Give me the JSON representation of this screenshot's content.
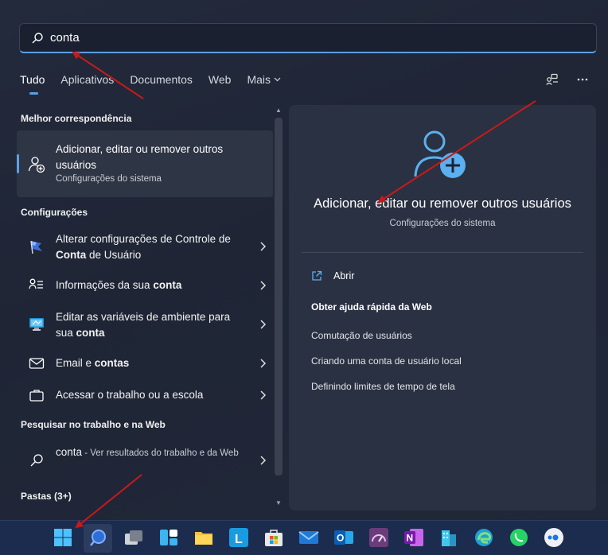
{
  "search": {
    "value": "conta"
  },
  "tabs": [
    {
      "label": "Tudo",
      "active": true
    },
    {
      "label": "Aplicativos"
    },
    {
      "label": "Documentos"
    },
    {
      "label": "Web"
    },
    {
      "label": "Mais"
    }
  ],
  "sections": {
    "best_match": "Melhor correspondência",
    "settings": "Configurações",
    "work_web": "Pesquisar no trabalho e na Web",
    "folders": "Pastas (3+)"
  },
  "best": {
    "title": "Adicionar, editar ou remover outros usuários",
    "subtitle": "Configurações do sistema"
  },
  "settings_items": [
    {
      "label": "Alterar configurações de Controle de Conta de Usuário",
      "icon": "uac-flag-icon"
    },
    {
      "label": "Informações da sua conta",
      "icon": "person-list-icon"
    },
    {
      "label": "Editar as variáveis de ambiente para sua conta",
      "icon": "monitor-settings-icon"
    },
    {
      "label": "Email e contas",
      "icon": "mail-icon"
    },
    {
      "label": "Acessar o trabalho ou a escola",
      "icon": "briefcase-icon"
    }
  ],
  "web_item": {
    "label": "conta",
    "suffix": " - Ver resultados do trabalho e da Web"
  },
  "right": {
    "title": "Adicionar, editar ou remover outros usuários",
    "subtitle": "Configurações do sistema",
    "open_label": "Abrir",
    "help_title": "Obter ajuda rápida da Web",
    "links": [
      "Comutação de usuários",
      "Criando uma conta de usuário local",
      "Definindo limites de tempo de tela"
    ]
  },
  "colors": {
    "accent": "#5aa0e6",
    "arrow": "#c81a1a"
  },
  "taskbar_icons": [
    "start-icon",
    "search-icon",
    "task-view-icon",
    "widgets-icon",
    "file-explorer-icon",
    "lync-icon",
    "store-icon",
    "mail-icon",
    "outlook-icon",
    "speed-icon",
    "onenote-icon",
    "building-icon",
    "edge-icon",
    "whatsapp-icon",
    "meet-icon"
  ]
}
